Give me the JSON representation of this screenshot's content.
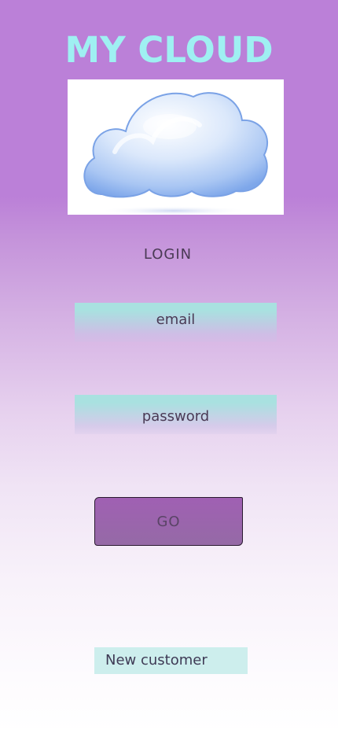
{
  "app": {
    "title": "MY CLOUD"
  },
  "login": {
    "heading": "LOGIN",
    "email_placeholder": "email",
    "password_placeholder": "password",
    "submit_label": "GO",
    "new_customer_label": "New customer"
  },
  "icons": {
    "logo": "cloud-icon"
  },
  "colors": {
    "background_top": "#bb80d8",
    "title": "#9ff0f2",
    "field": "#a9e1e0",
    "button": "#9b63ac",
    "new_customer": "#cdeeed"
  }
}
